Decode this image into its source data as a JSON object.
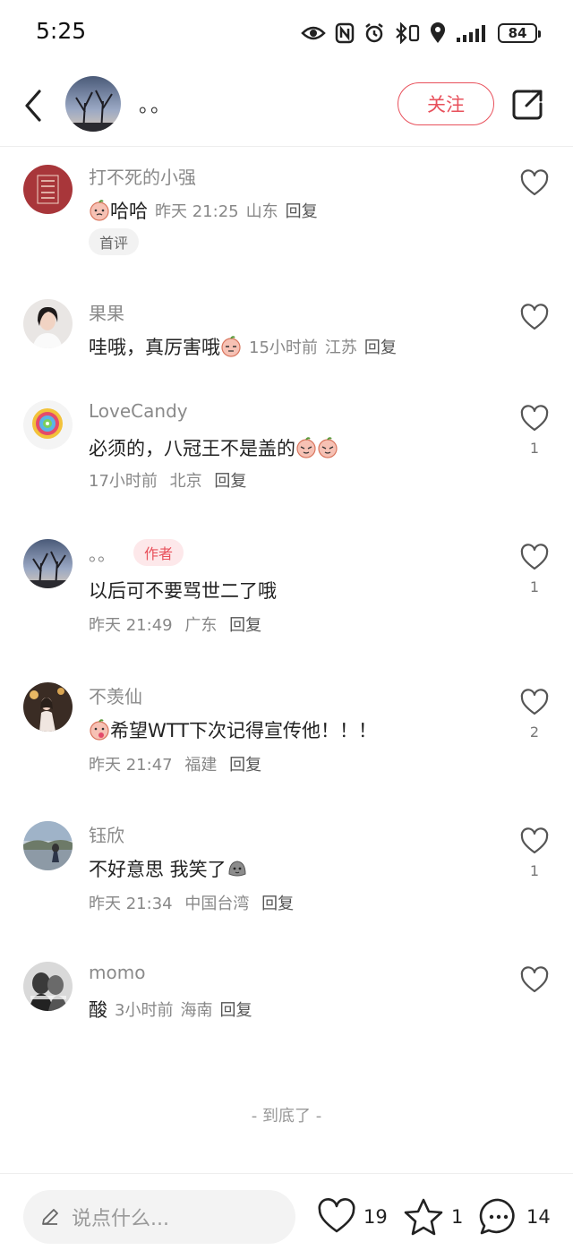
{
  "status_bar": {
    "time": "5:25",
    "battery": "84"
  },
  "header": {
    "author_name": "。。",
    "follow_label": "关注"
  },
  "comments": [
    {
      "name": "打不死的小强",
      "text": "哈哈",
      "time": "昨天 21:25",
      "location": "山东",
      "reply": "回复",
      "tag": "首评",
      "likes": ""
    },
    {
      "name": "果果",
      "text": "哇哦，真厉害哦",
      "time": "15小时前",
      "location": "江苏",
      "reply": "回复",
      "likes": ""
    },
    {
      "name": "LoveCandy",
      "text": "必须的，八冠王不是盖的",
      "time": "17小时前",
      "location": "北京",
      "reply": "回复",
      "likes": "1"
    },
    {
      "name": "。。",
      "author_tag": "作者",
      "text": "以后可不要骂世二了哦",
      "time": "昨天 21:49",
      "location": "广东",
      "reply": "回复",
      "likes": "1"
    },
    {
      "name": "不羡仙",
      "text": "希望WTT下次记得宣传他！！！",
      "time": "昨天 21:47",
      "location": "福建",
      "reply": "回复",
      "likes": "2"
    },
    {
      "name": "钰欣",
      "text": "不好意思 我笑了",
      "time": "昨天 21:34",
      "location": "中国台湾",
      "reply": "回复",
      "likes": "1"
    },
    {
      "name": "momo",
      "text": "酸",
      "time": "3小时前",
      "location": "海南",
      "reply": "回复",
      "likes": ""
    }
  ],
  "end_hint": "- 到底了 -",
  "bottom_bar": {
    "input_placeholder": "说点什么...",
    "likes": "19",
    "favorites": "1",
    "comments": "14"
  },
  "colors": {
    "accent": "#e8505b",
    "muted": "#888888"
  },
  "icons": [
    "back-icon",
    "share-icon",
    "heart-icon",
    "star-icon",
    "comment-icon",
    "pencil-icon"
  ]
}
